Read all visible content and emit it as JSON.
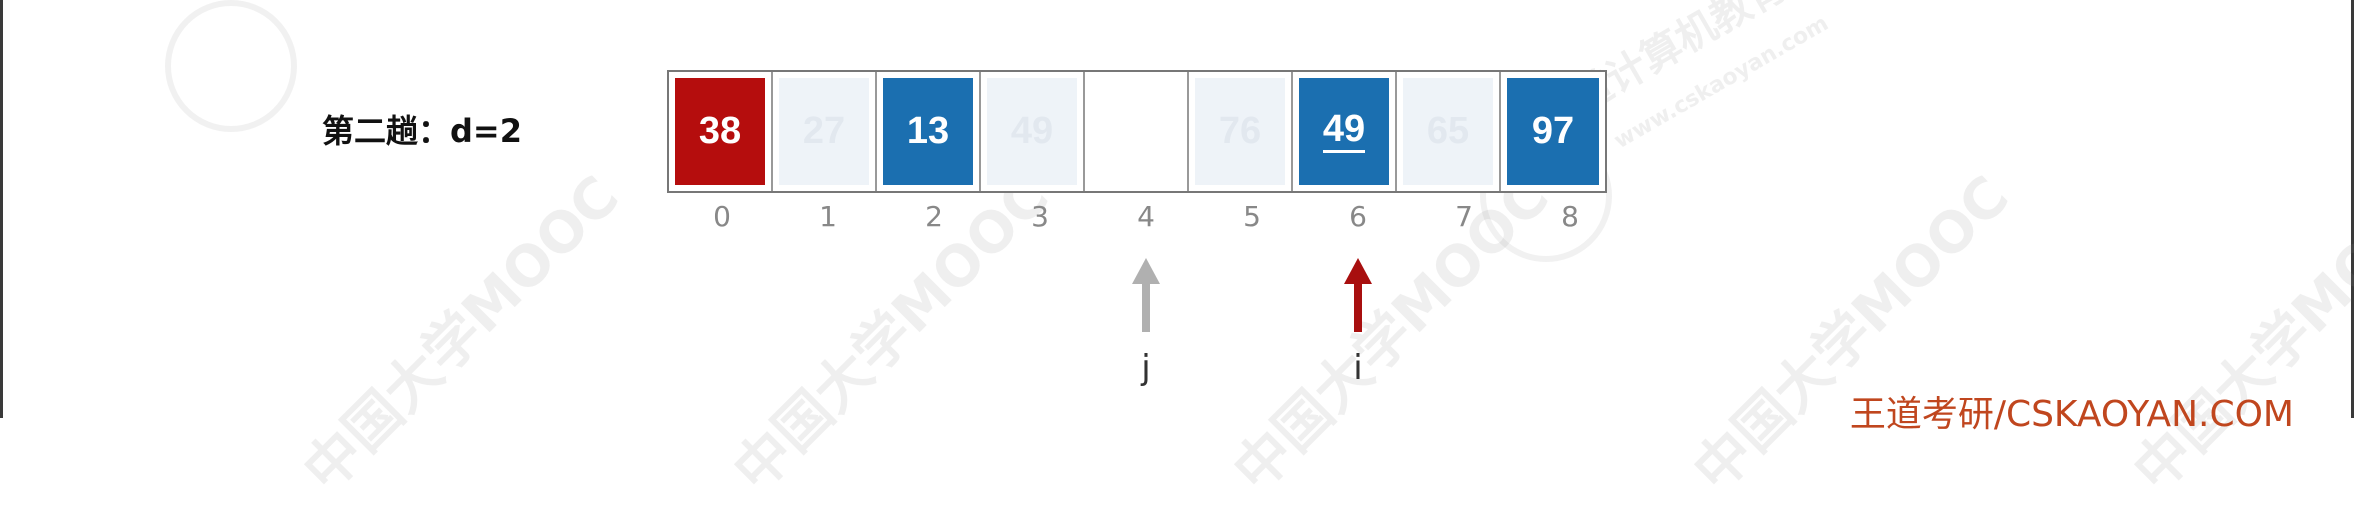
{
  "pass_label": "第二趟：d=2",
  "array": {
    "cells": [
      {
        "value": "38",
        "state": "red"
      },
      {
        "value": "27",
        "state": "faded"
      },
      {
        "value": "13",
        "state": "blue"
      },
      {
        "value": "49",
        "state": "faded"
      },
      {
        "value": "",
        "state": "empty"
      },
      {
        "value": "76",
        "state": "faded"
      },
      {
        "value": "49",
        "state": "blue",
        "underline": true
      },
      {
        "value": "65",
        "state": "faded"
      },
      {
        "value": "97",
        "state": "blue"
      }
    ],
    "indices": [
      "0",
      "1",
      "2",
      "3",
      "4",
      "5",
      "6",
      "7",
      "8"
    ]
  },
  "pointers": [
    {
      "label": "j",
      "color": "#b0b0b0",
      "at_index": 4
    },
    {
      "label": "i",
      "color": "#a80f0f",
      "at_index": 6
    }
  ],
  "colors": {
    "red": "#b50d0d",
    "blue": "#1b6fb0",
    "brand": "#c0461e"
  },
  "watermarks": {
    "mooc": "中国大学MOOC",
    "seal": "王道计算机教育",
    "url": "www.cskaoyan.com"
  },
  "brand": "王道考研/CSKAOYAN.COM"
}
